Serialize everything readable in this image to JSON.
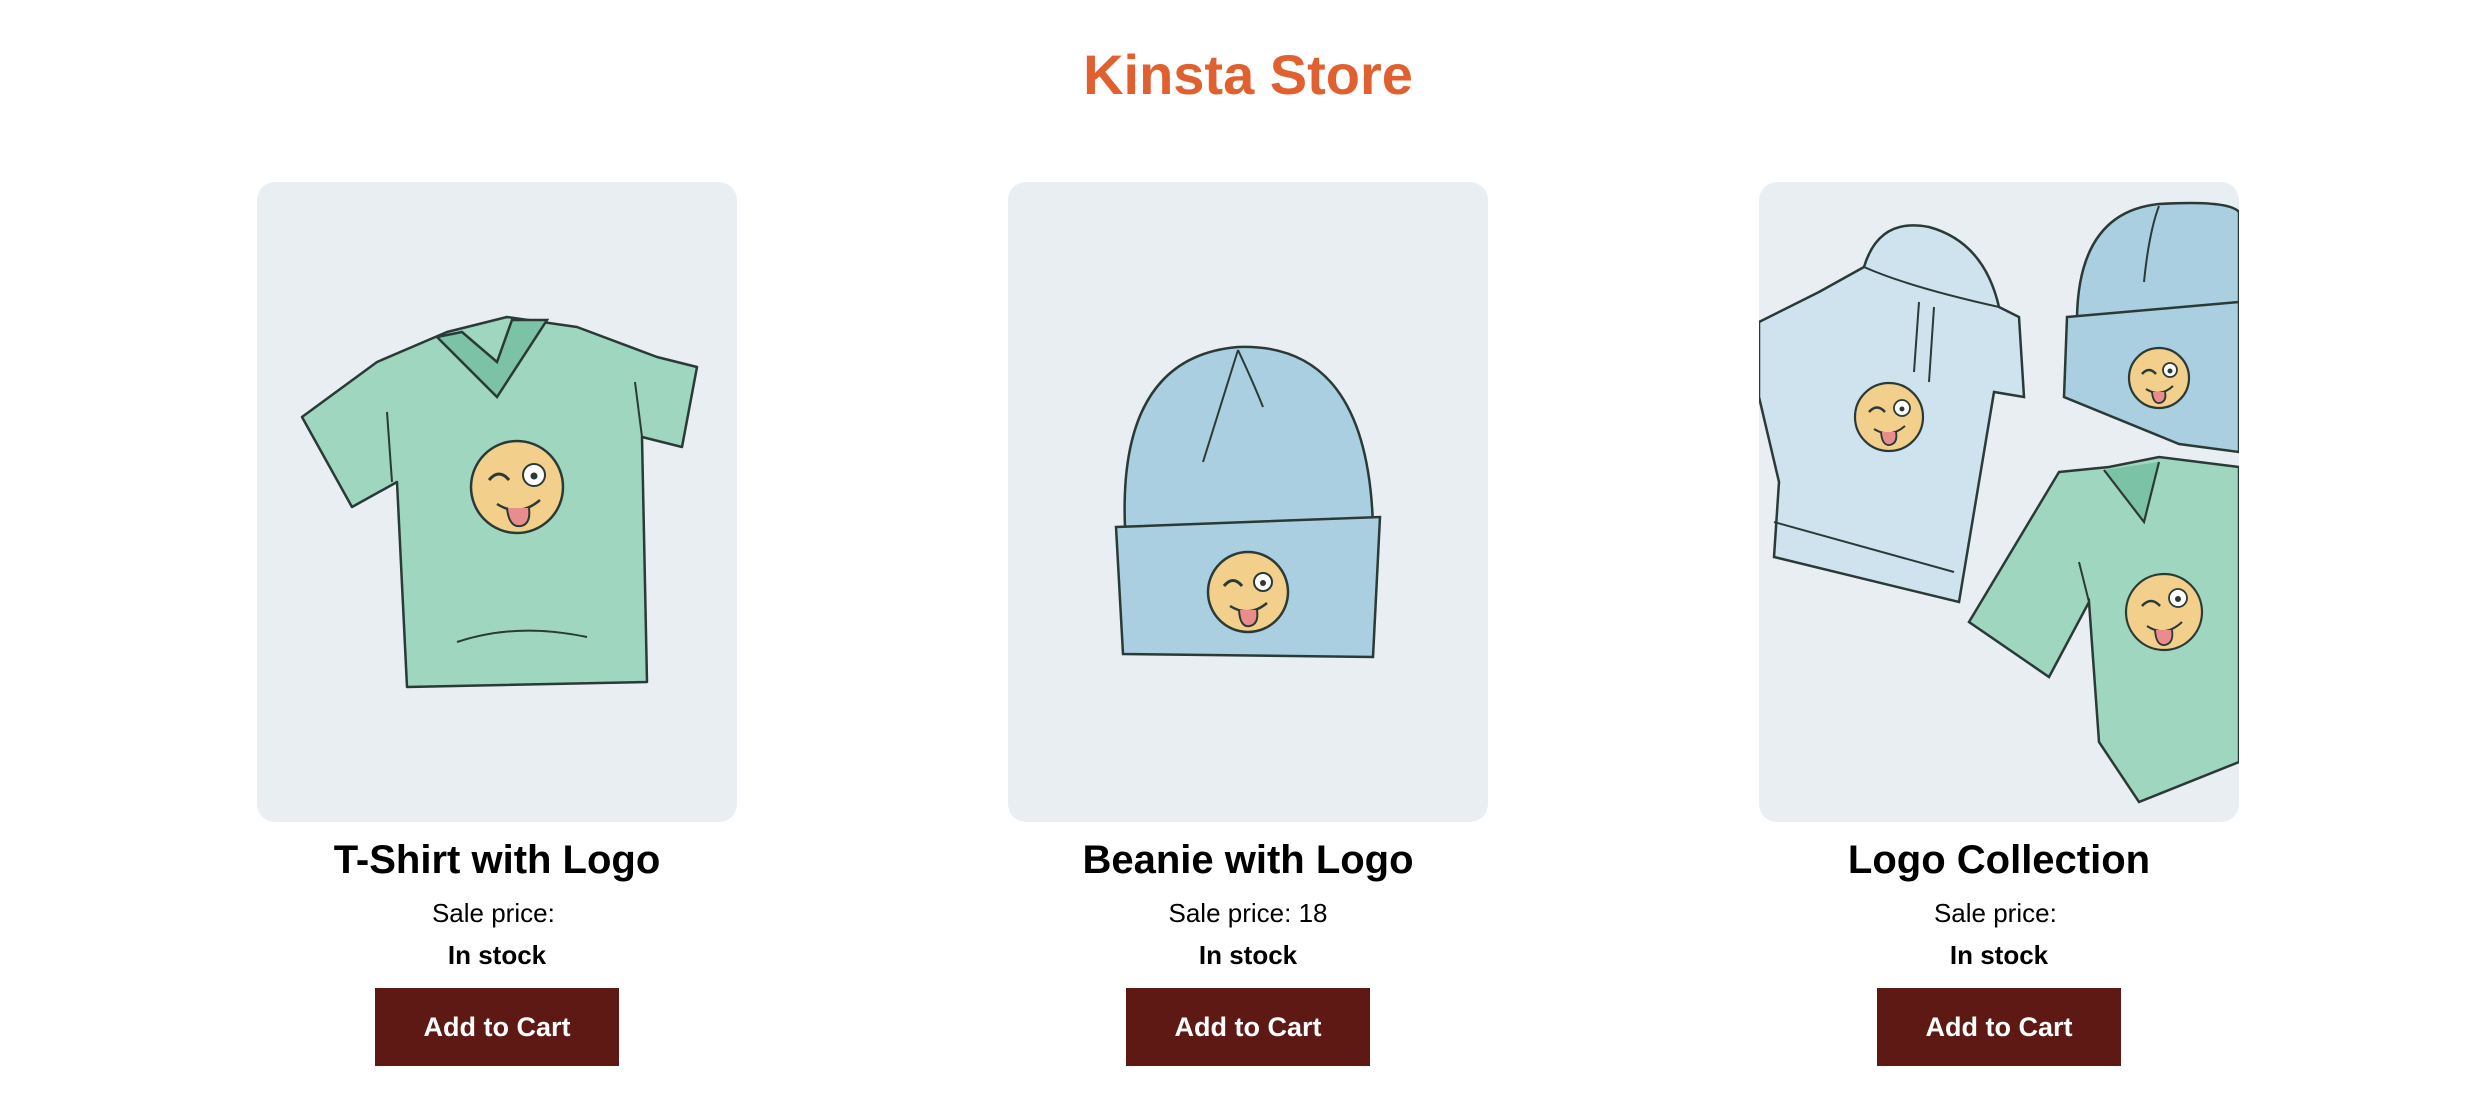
{
  "store": {
    "title": "Kinsta Store",
    "accent_color": "#e06030"
  },
  "products": [
    {
      "name": "T-Shirt with Logo",
      "sale_price_label": "Sale price:",
      "sale_price_value": "",
      "stock_status": "In stock",
      "cart_label": "Add to Cart",
      "image_icon": "tshirt-illustration"
    },
    {
      "name": "Beanie with Logo",
      "sale_price_label": "Sale price:",
      "sale_price_value": "18",
      "stock_status": "In stock",
      "cart_label": "Add to Cart",
      "image_icon": "beanie-illustration"
    },
    {
      "name": "Logo Collection",
      "sale_price_label": "Sale price:",
      "sale_price_value": "",
      "stock_status": "In stock",
      "cart_label": "Add to Cart",
      "image_icon": "logo-collection-illustration"
    }
  ],
  "colors": {
    "button_bg": "#5e1914",
    "image_bg": "#e9eef2",
    "tshirt_green": "#9fd6bf",
    "beanie_blue": "#a9cfe0",
    "hoodie_blue": "#cfe3ee",
    "emoji_yellow": "#f3cf8c"
  }
}
